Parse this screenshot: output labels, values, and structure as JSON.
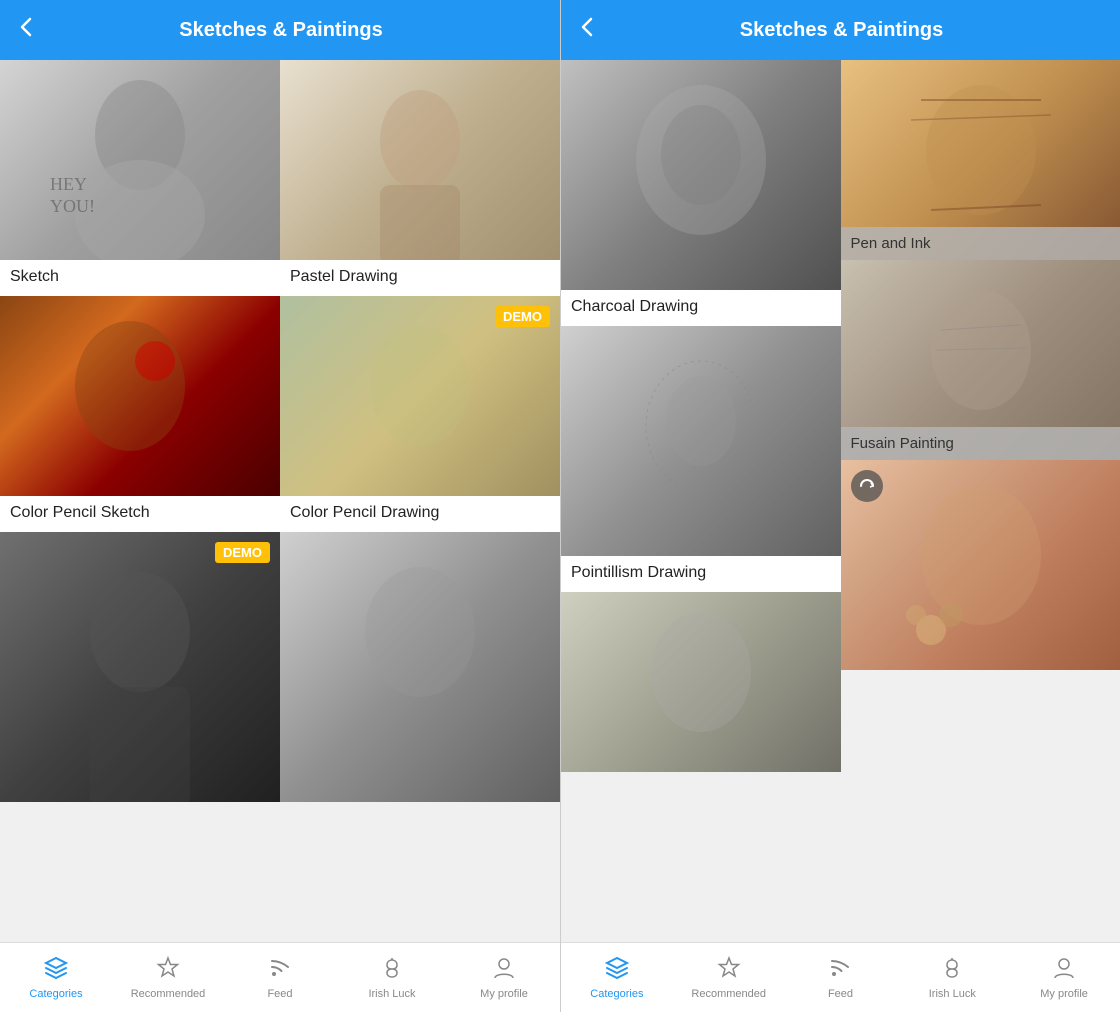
{
  "left_panel": {
    "header": {
      "title": "Sketches & Paintings",
      "back_label": "‹"
    },
    "filters": [
      {
        "id": "sketch",
        "label": "Sketch",
        "demo": false,
        "bg": "bg-sketch"
      },
      {
        "id": "pastel",
        "label": "Pastel Drawing",
        "demo": false,
        "bg": "bg-pastel"
      },
      {
        "id": "color-sketch",
        "label": "Color Pencil Sketch",
        "demo": false,
        "bg": "bg-color-sketch"
      },
      {
        "id": "color-pencil",
        "label": "Color Pencil Drawing",
        "demo": true,
        "bg": "bg-color-pencil"
      },
      {
        "id": "new-item",
        "label": "",
        "demo": true,
        "bg": "bg-new-item"
      },
      {
        "id": "bottom-sketch",
        "label": "",
        "demo": false,
        "bg": "bg-bottom-sketch"
      }
    ],
    "tab_bar": {
      "items": [
        {
          "id": "categories",
          "label": "Categories",
          "active": true
        },
        {
          "id": "recommended",
          "label": "Recommended",
          "active": false
        },
        {
          "id": "feed",
          "label": "Feed",
          "active": false
        },
        {
          "id": "irish-luck",
          "label": "Irish Luck",
          "active": false
        },
        {
          "id": "my-profile",
          "label": "My profile",
          "active": false
        }
      ]
    }
  },
  "right_panel": {
    "header": {
      "title": "Sketches & Paintings",
      "back_label": "‹"
    },
    "filters": [
      {
        "id": "charcoal",
        "label": "Charcoal Drawing",
        "demo": false,
        "bg": "bg-charcoal"
      },
      {
        "id": "pen-ink",
        "label": "Pen and Ink",
        "demo": false,
        "bg": "bg-pen-ink"
      },
      {
        "id": "fusain",
        "label": "Fusain Painting",
        "demo": false,
        "bg": "bg-fusain"
      },
      {
        "id": "pointillism",
        "label": "Pointillism Drawing",
        "demo": false,
        "bg": "bg-pointillism"
      },
      {
        "id": "double-exp",
        "label": "",
        "demo": false,
        "bg": "bg-double-exp"
      },
      {
        "id": "bottom-right",
        "label": "",
        "demo": false,
        "bg": "bg-bottom-right"
      }
    ],
    "tab_bar": {
      "items": [
        {
          "id": "categories",
          "label": "Categories",
          "active": true
        },
        {
          "id": "recommended",
          "label": "Recommended",
          "active": false
        },
        {
          "id": "feed",
          "label": "Feed",
          "active": false
        },
        {
          "id": "irish-luck",
          "label": "Irish Luck",
          "active": false
        },
        {
          "id": "my-profile",
          "label": "My profile",
          "active": false
        }
      ]
    }
  }
}
